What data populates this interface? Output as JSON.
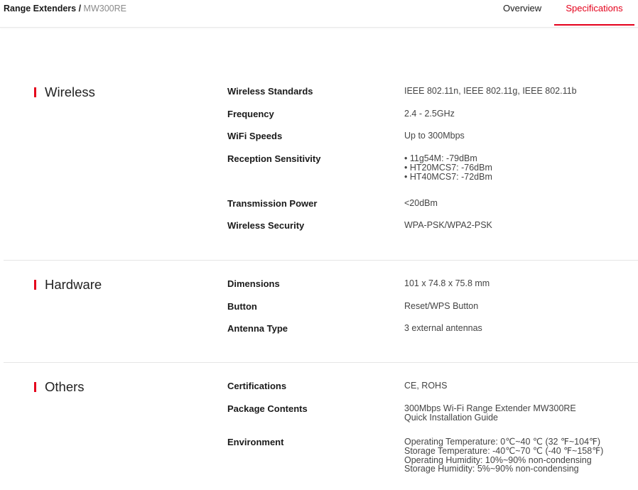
{
  "breadcrumb": {
    "parent": "Range Extenders",
    "separator": " / ",
    "current": "MW300RE"
  },
  "tabs": [
    {
      "label": "Overview",
      "active": false
    },
    {
      "label": "Specifications",
      "active": true
    }
  ],
  "colors": {
    "accent": "#e4001b",
    "divider": "#e5e5e5"
  },
  "sections": [
    {
      "title": "Wireless",
      "specs": [
        {
          "label": "Wireless Standards",
          "values": [
            "IEEE 802.11n, IEEE 802.11g, IEEE 802.11b"
          ]
        },
        {
          "label": "Frequency",
          "values": [
            "2.4 - 2.5GHz"
          ]
        },
        {
          "label": "WiFi Speeds",
          "values": [
            "Up to 300Mbps"
          ]
        },
        {
          "label": "Reception Sensitivity",
          "values": [
            "• 11g54M: -79dBm",
            "• HT20MCS7: -76dBm",
            "• HT40MCS7: -72dBm"
          ]
        },
        {
          "label": "Transmission Power",
          "values": [
            "<20dBm"
          ]
        },
        {
          "label": "Wireless Security",
          "values": [
            "WPA-PSK/WPA2-PSK"
          ]
        }
      ]
    },
    {
      "title": "Hardware",
      "specs": [
        {
          "label": "Dimensions",
          "values": [
            "101 x 74.8 x 75.8 mm"
          ]
        },
        {
          "label": "Button",
          "values": [
            "Reset/WPS Button"
          ]
        },
        {
          "label": "Antenna Type",
          "values": [
            "3 external antennas"
          ]
        }
      ]
    },
    {
      "title": "Others",
      "specs": [
        {
          "label": "Certifications",
          "values": [
            "CE, ROHS"
          ]
        },
        {
          "label": "Package Contents",
          "values": [
            "300Mbps Wi-Fi Range Extender MW300RE",
            "Quick Installation Guide"
          ]
        },
        {
          "label": "Environment",
          "values": [
            "Operating Temperature: 0℃~40 ℃ (32 ℉~104℉)",
            "Storage Temperature: -40℃~70 ℃ (-40 ℉~158℉)",
            "Operating Humidity: 10%~90% non-condensing",
            "Storage Humidity: 5%~90% non-condensing"
          ]
        }
      ]
    }
  ]
}
